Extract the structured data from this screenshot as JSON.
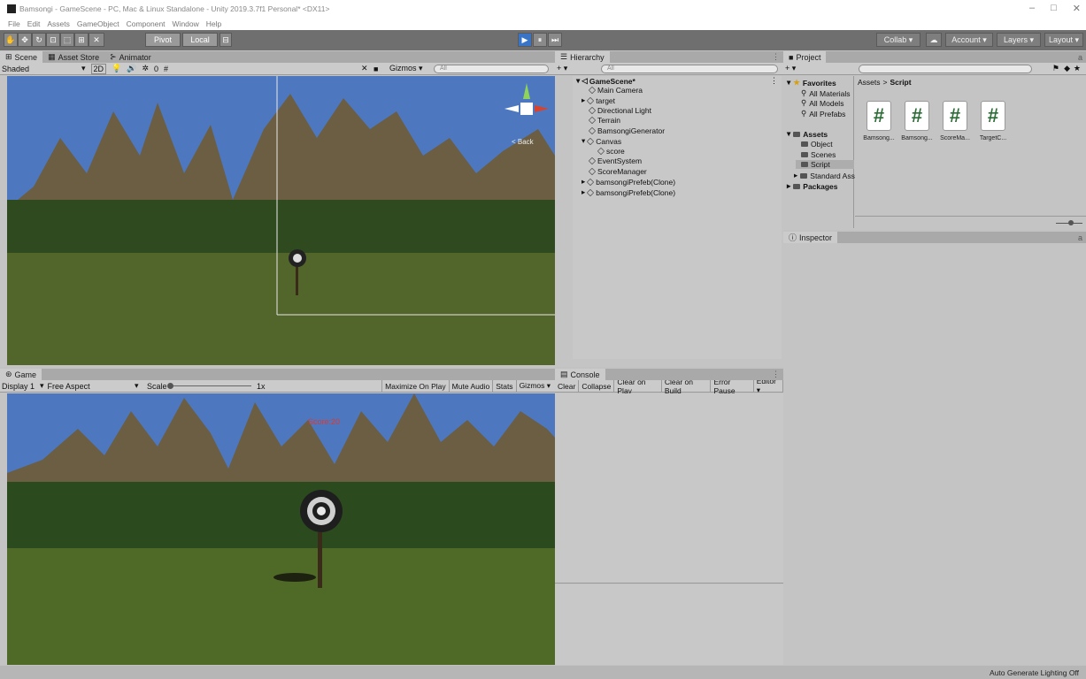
{
  "window": {
    "title": "Bamsongi - GameScene - PC, Mac & Linux Standalone - Unity 2019.3.7f1 Personal* <DX11>",
    "min": "–",
    "max": "□",
    "close": "✕"
  },
  "menu": [
    "File",
    "Edit",
    "Assets",
    "GameObject",
    "Component",
    "Window",
    "Help"
  ],
  "toolbar": {
    "pivot": "Pivot",
    "local": "Local",
    "play": "▶",
    "pause": "⏸",
    "step": "⏭",
    "collab": "Collab ▾",
    "account": "Account ▾",
    "layers": "Layers ▾",
    "layout": "Layout ▾"
  },
  "scene": {
    "tabs": [
      "Scene",
      "Asset Store",
      "Animator"
    ],
    "shading": "Shaded",
    "mode2d": "2D",
    "fx_count": "0",
    "gizmos": "Gizmos ▾",
    "search_placeholder": "All",
    "gizmo_back": "< Back"
  },
  "game": {
    "tab": "Game",
    "display": "Display 1",
    "aspect": "Free Aspect",
    "scale_label": "Scale",
    "scale_value": "1x",
    "buttons": [
      "Maximize On Play",
      "Mute Audio",
      "Stats",
      "Gizmos ▾"
    ],
    "score_text": "Score:20"
  },
  "hierarchy": {
    "title": "Hierarchy",
    "add": "+ ▾",
    "search_placeholder": "All",
    "scene": "GameScene*",
    "items": [
      "Main Camera",
      "target",
      "Directional Light",
      "Terrain",
      "BamsongiGenerator",
      "Canvas",
      "score",
      "EventSystem",
      "ScoreManager",
      "bamsongiPrefeb(Clone)",
      "bamsongiPrefeb(Clone)"
    ]
  },
  "console": {
    "title": "Console",
    "buttons": [
      "Clear",
      "Collapse",
      "Clear on Play",
      "Clear on Build",
      "Error Pause",
      "Editor ▾"
    ]
  },
  "project": {
    "title": "Project",
    "add": "+ ▾",
    "favorites": "Favorites",
    "fav_items": [
      "All Materials",
      "All Models",
      "All Prefabs"
    ],
    "assets": "Assets",
    "asset_folders": [
      "Object",
      "Scenes",
      "Script",
      "Standard Ass"
    ],
    "packages": "Packages",
    "breadcrumb_root": "Assets",
    "breadcrumb_sep": ">",
    "breadcrumb_current": "Script",
    "files": [
      "Bamsong...",
      "Bamsong...",
      "ScoreMa...",
      "TargetC..."
    ]
  },
  "inspector": {
    "title": "Inspector"
  },
  "status": {
    "text": "Auto Generate Lighting Off"
  },
  "colors": {
    "toolbar": "#6f6f6f",
    "panel": "#c4c4c4",
    "accent": "#3a74c6",
    "score": "#e0362c"
  }
}
